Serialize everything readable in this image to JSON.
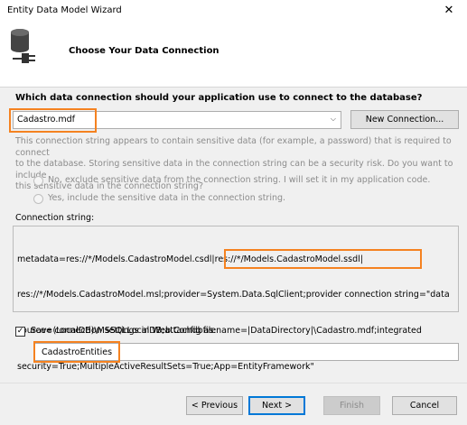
{
  "window": {
    "title": "Entity Data Model Wizard",
    "close_glyph": "✕"
  },
  "header": {
    "title": "Choose Your Data Connection",
    "icon": "database-connection-icon"
  },
  "question": "Which data connection should your application use to connect to the database?",
  "connection_select": {
    "value": "Cadastro.mdf",
    "arrow": "⌵"
  },
  "new_connection_label": "New Connection...",
  "sensitive_notice": {
    "line1": "This connection string appears to contain sensitive data (for example, a password) that is required to connect",
    "line2": "to the database. Storing sensitive data in the connection string can be a security risk. Do you want to include",
    "line3": "this sensitive data in the connection string?"
  },
  "radio_options": {
    "exclude": "No, exclude sensitive data from the connection string. I will set it in my application code.",
    "include": "Yes, include the sensitive data in the connection string."
  },
  "connection_string_label": "Connection string:",
  "connection_string_lines": {
    "l1": "metadata=res://*/Models.CadastroModel.csdl|res://*/Models.CadastroModel.ssdl|",
    "l2": "res://*/Models.CadastroModel.msl;provider=System.Data.SqlClient;provider connection string=\"data",
    "l3": "source=(LocalDB)\\MSSQLLocalDB;attachdbfilename=|DataDirectory|\\Cadastro.mdf;integrated",
    "l4": "security=True;MultipleActiveResultSets=True;App=EntityFramework\""
  },
  "save_settings": {
    "checked": true,
    "check_glyph": "✓",
    "label": "Save connection settings in Web.Config as:"
  },
  "entity_name": "CadastroEntities",
  "buttons": {
    "previous": "< Previous",
    "next": "Next >",
    "finish": "Finish",
    "cancel": "Cancel"
  },
  "highlight_color": "#f58220"
}
